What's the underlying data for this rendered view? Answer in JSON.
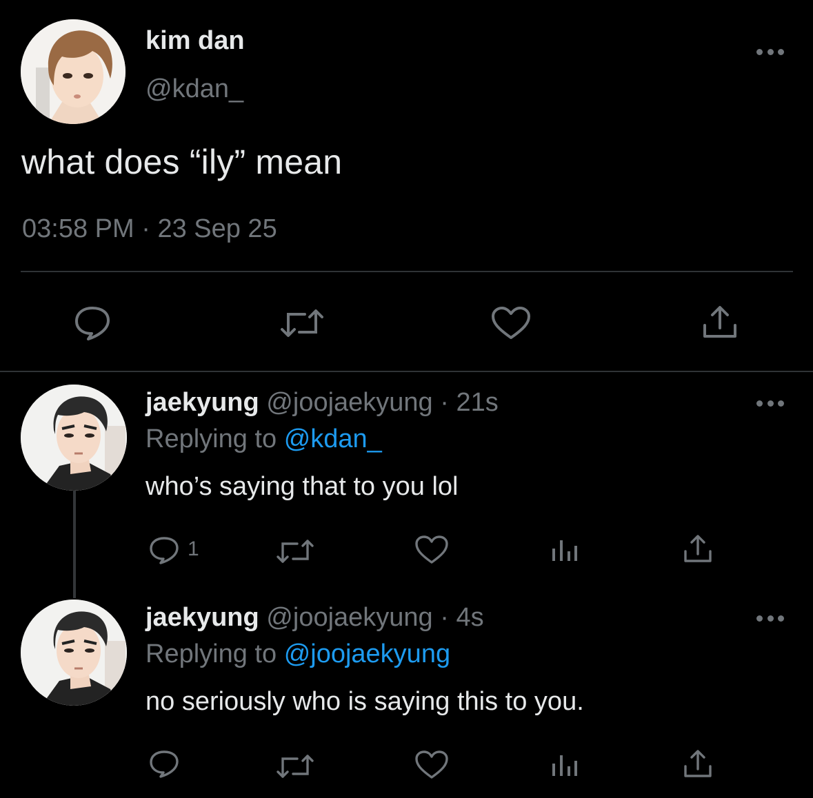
{
  "main_tweet": {
    "author_name": "kim dan",
    "author_handle": "@kdan_",
    "text": "what does “ily” mean",
    "time": "03:58 PM",
    "separator": "·",
    "date": "23 Sep 25",
    "actions": [
      "reply-icon",
      "retweet-icon",
      "like-icon",
      "share-icon"
    ]
  },
  "replies": [
    {
      "author_name": "jaekyung",
      "author_handle": "@joojaekyung",
      "separator": "·",
      "time_ago": "21s",
      "replying_prefix": "Replying to",
      "replying_to": "@kdan_",
      "text": "who’s saying that to you lol",
      "reply_count": "1",
      "actions": [
        "reply-icon",
        "retweet-icon",
        "like-icon",
        "views-icon",
        "share-icon"
      ]
    },
    {
      "author_name": "jaekyung",
      "author_handle": "@joojaekyung",
      "separator": "·",
      "time_ago": "4s",
      "replying_prefix": "Replying to",
      "replying_to": "@joojaekyung",
      "text": "no seriously who is saying this to you.",
      "reply_count": "",
      "actions": [
        "reply-icon",
        "retweet-icon",
        "like-icon",
        "views-icon",
        "share-icon"
      ]
    }
  ],
  "colors": {
    "background": "#000000",
    "primary_text": "#e7e9ea",
    "secondary_text": "#71767b",
    "link": "#1d9bf0",
    "divider": "#2f3336"
  }
}
